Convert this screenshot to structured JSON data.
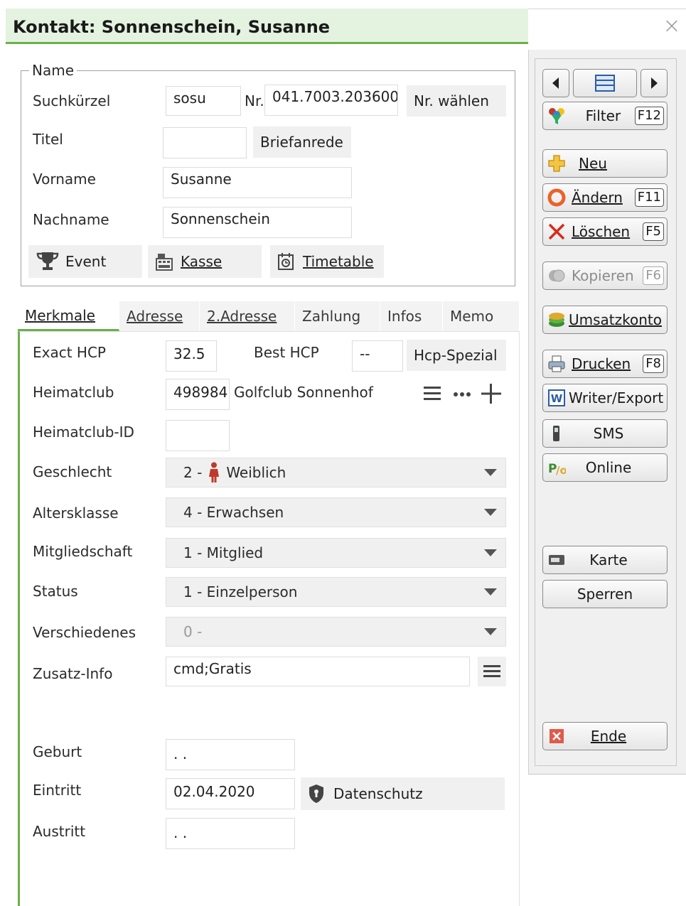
{
  "window": {
    "title": "Kontakt: Sonnenschein, Susanne",
    "close_glyph": "×"
  },
  "name_group": {
    "legend": "Name",
    "suchkuerzel_label": "Suchkürzel",
    "suchkuerzel_value": "sosu",
    "nr_label": "Nr.",
    "nr_value": "041.7003.203600",
    "nr_waehlen_button": "Nr. wählen",
    "titel_label": "Titel",
    "titel_value": "",
    "briefanrede_button": "Briefanrede",
    "vorname_label": "Vorname",
    "vorname_value": "Susanne",
    "nachname_label": "Nachname",
    "nachname_value": "Sonnenschein",
    "event_button": "Event",
    "kasse_button": "Kasse",
    "timetable_button": "Timetable"
  },
  "tabs": [
    {
      "label": "Merkmale",
      "active": true
    },
    {
      "label": "Adresse"
    },
    {
      "label": "2.Adresse"
    },
    {
      "label": "Zahlung"
    },
    {
      "label": "Infos"
    },
    {
      "label": "Memo"
    }
  ],
  "merkmale": {
    "exact_hcp_label": "Exact HCP",
    "exact_hcp_value": "32.5",
    "best_hcp_label": "Best HCP",
    "best_hcp_value": "--",
    "hcp_spezial_button": "Hcp-Spezial",
    "heimatclub_label": "Heimatclub",
    "heimatclub_nr": "498984",
    "heimatclub_name": "Golfclub Sonnenhof",
    "heimatclub_id_label": "Heimatclub-ID",
    "heimatclub_id_value": "",
    "geschlecht_label": "Geschlecht",
    "geschlecht_prefix": "2 -",
    "geschlecht_value": "Weiblich",
    "altersklasse_label": "Altersklasse",
    "altersklasse_value": "4 - Erwachsen",
    "mitgliedschaft_label": "Mitgliedschaft",
    "mitgliedschaft_value": "1 - Mitglied",
    "status_label": "Status",
    "status_value": "1 - Einzelperson",
    "verschiedenes_label": "Verschiedenes",
    "verschiedenes_value": "0 -",
    "zusatz_info_label": "Zusatz-Info",
    "zusatz_info_value": "cmd;Gratis",
    "geburt_label": "Geburt",
    "geburt_value": ". .",
    "eintritt_label": "Eintritt",
    "eintritt_value": "02.04.2020",
    "datenschutz_button": "Datenschutz",
    "austritt_label": "Austritt",
    "austritt_value": ". ."
  },
  "right_panel": {
    "filter": {
      "label": "Filter",
      "key": "F12"
    },
    "neu": {
      "label": "Neu"
    },
    "aendern": {
      "label": "Ändern",
      "key": "F11"
    },
    "loeschen": {
      "label": "Löschen",
      "key": "F5"
    },
    "kopieren": {
      "label": "Kopieren",
      "key": "F6"
    },
    "umsatzkonto": {
      "label": "Umsatzkonto"
    },
    "drucken": {
      "label": "Drucken",
      "key": "F8"
    },
    "writer_export": {
      "label": "Writer/Export"
    },
    "sms": {
      "label": "SMS"
    },
    "online": {
      "label": "Online"
    },
    "karte": {
      "label": "Karte"
    },
    "sperren": {
      "label": "Sperren"
    },
    "ende": {
      "label": "Ende"
    }
  },
  "colors": {
    "accent_green": "#6ab04c",
    "title_bg": "#e4f3df",
    "panel_bg": "#f0f0f0"
  }
}
